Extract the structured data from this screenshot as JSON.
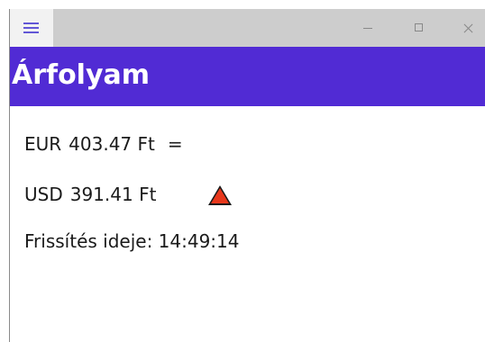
{
  "window": {
    "controls": {
      "minimize_icon": "minimize-icon",
      "maximize_icon": "maximize-icon",
      "close_icon": "close-icon"
    },
    "menu_icon": "hamburger-menu-icon"
  },
  "header": {
    "title": "Árfolyam",
    "background_color": "#512bd4"
  },
  "rates": [
    {
      "currency": "EUR",
      "value": "403.47",
      "unit": "Ft",
      "trend": "=",
      "trend_type": "unchanged"
    },
    {
      "currency": "USD",
      "value": "391.41",
      "unit": "Ft",
      "trend_icon": "triangle-up-icon",
      "trend_type": "up",
      "trend_color": "#e8381c"
    }
  ],
  "refresh": {
    "label": "Frissítés ideje:",
    "time": "14:49:14"
  }
}
